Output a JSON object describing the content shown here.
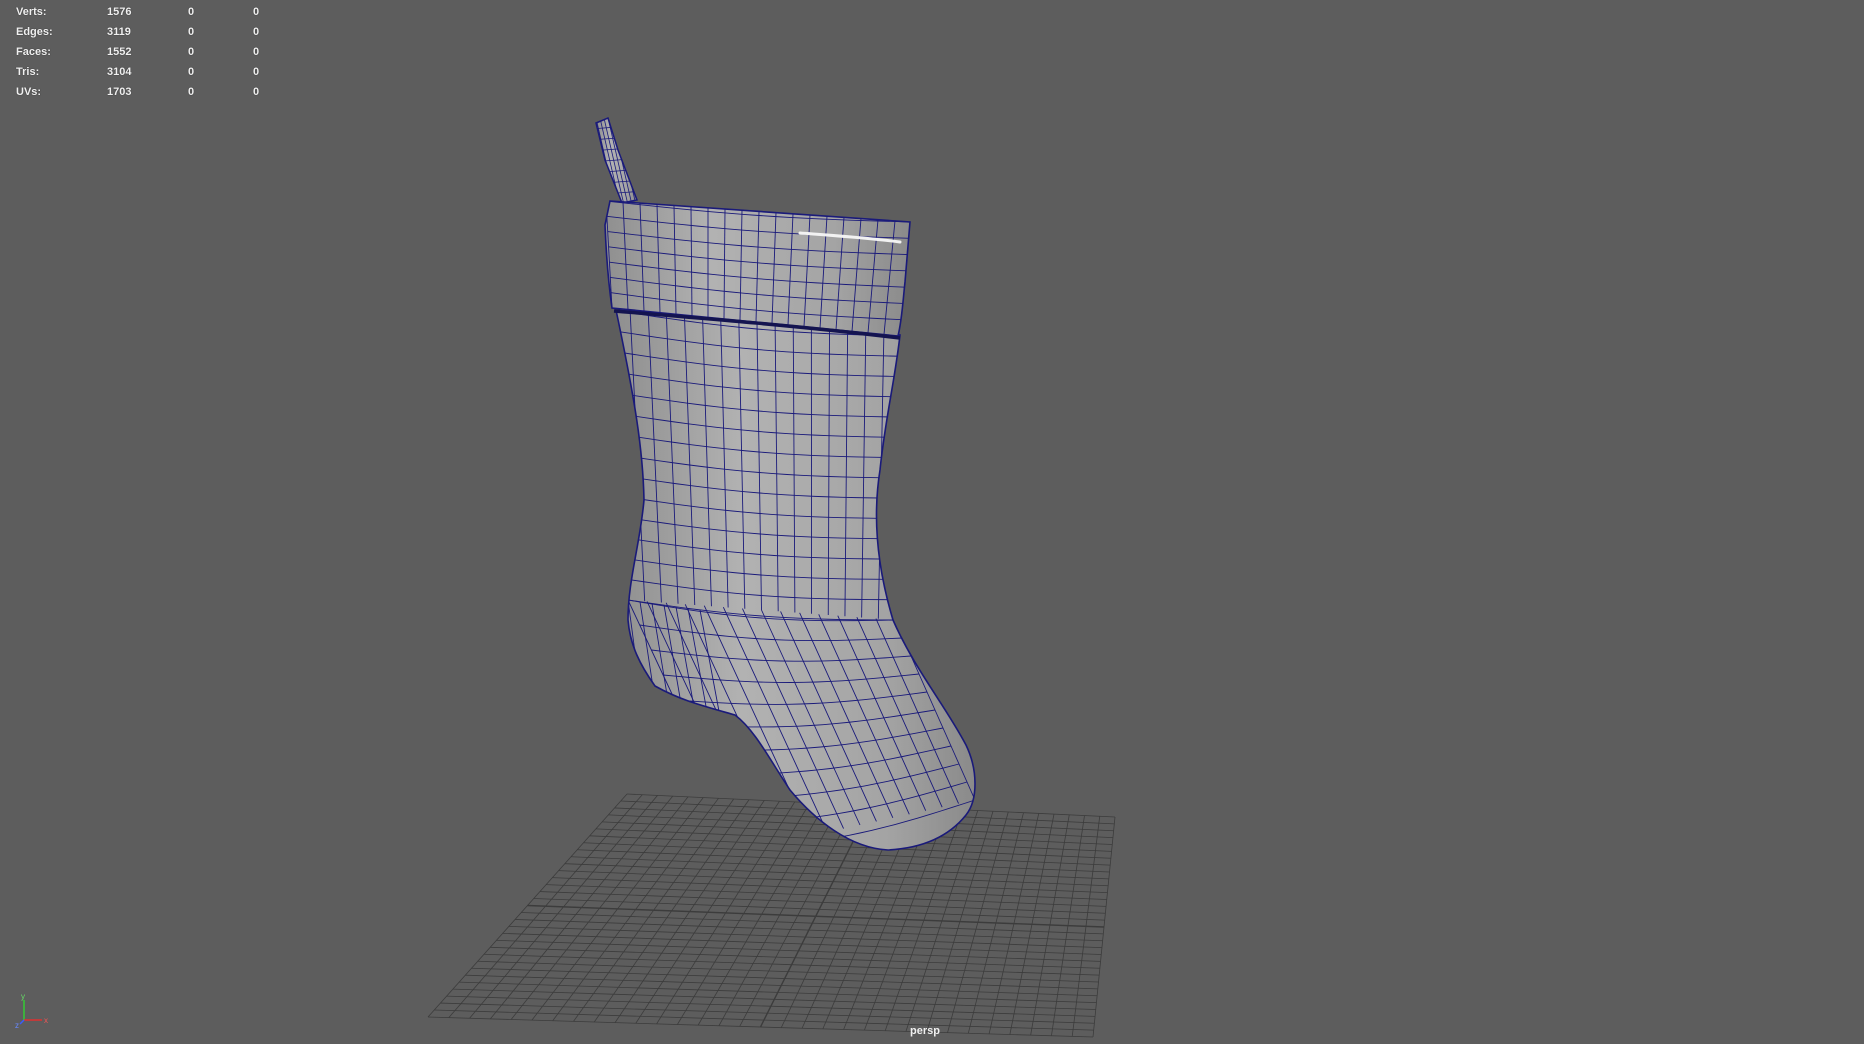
{
  "hud": {
    "rows": [
      {
        "label": "Verts:",
        "total": "1576",
        "selected": "0",
        "component": "0"
      },
      {
        "label": "Edges:",
        "total": "3119",
        "selected": "0",
        "component": "0"
      },
      {
        "label": "Faces:",
        "total": "1552",
        "selected": "0",
        "component": "0"
      },
      {
        "label": "Tris:",
        "total": "3104",
        "selected": "0",
        "component": "0"
      },
      {
        "label": "UVs:",
        "total": "1703",
        "selected": "0",
        "component": "0"
      }
    ]
  },
  "viewport": {
    "camera": "persp",
    "background_color": "#5d5d5d",
    "wireframe_color": "#1a1a7a",
    "mesh_color": "#a6a6a6",
    "grid_color": "#3c3c3c"
  },
  "axis_gizmo": {
    "y_label": "y",
    "z_label": "z",
    "x_label": "x"
  }
}
